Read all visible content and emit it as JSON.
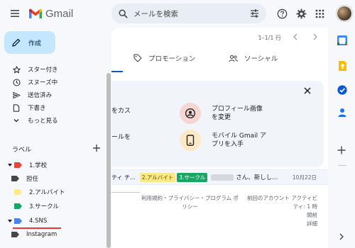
{
  "app": {
    "logo_text": "Gmail"
  },
  "search": {
    "placeholder": "メールを検索"
  },
  "compose": {
    "label": "作成"
  },
  "nav": {
    "items": [
      {
        "name": "starred",
        "label": "スター付き",
        "icon": "star-icon"
      },
      {
        "name": "snoozed",
        "label": "スヌーズ中",
        "icon": "clock-icon"
      },
      {
        "name": "sent",
        "label": "送信済み",
        "icon": "send-icon"
      },
      {
        "name": "drafts",
        "label": "下書き",
        "icon": "draft-icon"
      },
      {
        "name": "more",
        "label": "もっと見る",
        "icon": "chevron-down-icon"
      }
    ]
  },
  "labels": {
    "heading": "ラベル",
    "items": [
      {
        "label": "1.学校",
        "color": "#e8453c",
        "expanded": true,
        "sub": false
      },
      {
        "label": "担任",
        "color": "#444746",
        "sub": true
      },
      {
        "label": "2.アルバイト",
        "color": "#fbe983",
        "sub": false
      },
      {
        "label": "3.サークル",
        "color": "#16a765",
        "sub": false
      },
      {
        "label": "4.SNS",
        "color": "#4986e7",
        "expanded": true,
        "sub": false
      },
      {
        "label": "Instagram",
        "color": "#444746",
        "sub": true
      }
    ]
  },
  "main": {
    "pagination": "1–1/1 行",
    "tabs": [
      {
        "label": "プロモーション",
        "icon": "tag-icon"
      },
      {
        "label": "ソーシャル",
        "icon": "people-icon"
      }
    ],
    "setup": {
      "left_lines": [
        "をカス",
        "ールを"
      ],
      "profile": {
        "line1": "プロフィール画像",
        "line2": "を変更"
      },
      "mobile": {
        "line1": "モバイル Gmail ア",
        "line2": "プリを入手"
      }
    },
    "email": {
      "subject": "ティ チ...",
      "chips": [
        {
          "label": "2.アルバイト",
          "bg": "#fbe983",
          "fg": "#5f4b00"
        },
        {
          "label": "3.サークル",
          "bg": "#16a765",
          "fg": "#ffffff"
        }
      ],
      "snippet": "さん、新しし...",
      "date": "10月22日"
    },
    "footer": {
      "links_line1": "利用規約・プライバシー・プログラム ポ",
      "links_line2": "リシー",
      "activity_line1": "前回のアカウント アクティビティ: 1 時",
      "activity_line2": "間前",
      "activity_line3": "詳細"
    }
  },
  "colors": {
    "accent": "#0b57d0",
    "compose_bg": "#c2e7ff",
    "page_bg": "#f6f8fc"
  }
}
